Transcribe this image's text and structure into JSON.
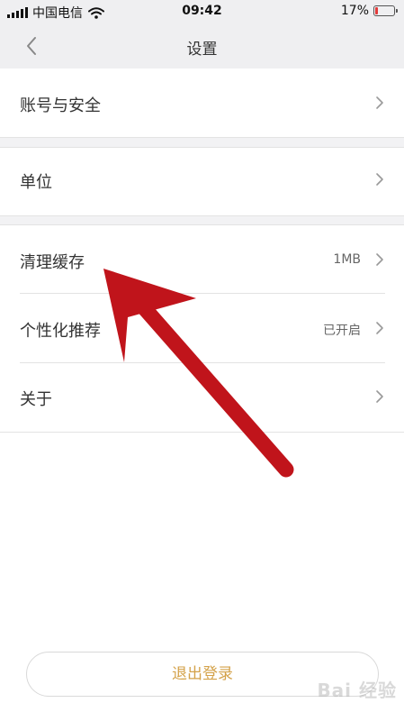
{
  "status_bar": {
    "carrier": "中国电信",
    "time": "09:42",
    "battery_percent": "17%",
    "battery_level": 0.17
  },
  "navbar": {
    "title": "设置",
    "back_icon": "chevron-left-icon"
  },
  "settings": {
    "account_security": {
      "label": "账号与安全"
    },
    "unit": {
      "label": "单位"
    },
    "clear_cache": {
      "label": "清理缓存",
      "value": "1MB"
    },
    "personalized_recommend": {
      "label": "个性化推荐",
      "value": "已开启"
    },
    "about": {
      "label": "关于"
    }
  },
  "logout_button": {
    "label": "退出登录"
  },
  "watermark": {
    "text": "Bai 经验"
  },
  "colors": {
    "accent": "#d4a24a",
    "annotation_arrow": "#c0141b",
    "background_gray": "#efeff1"
  }
}
